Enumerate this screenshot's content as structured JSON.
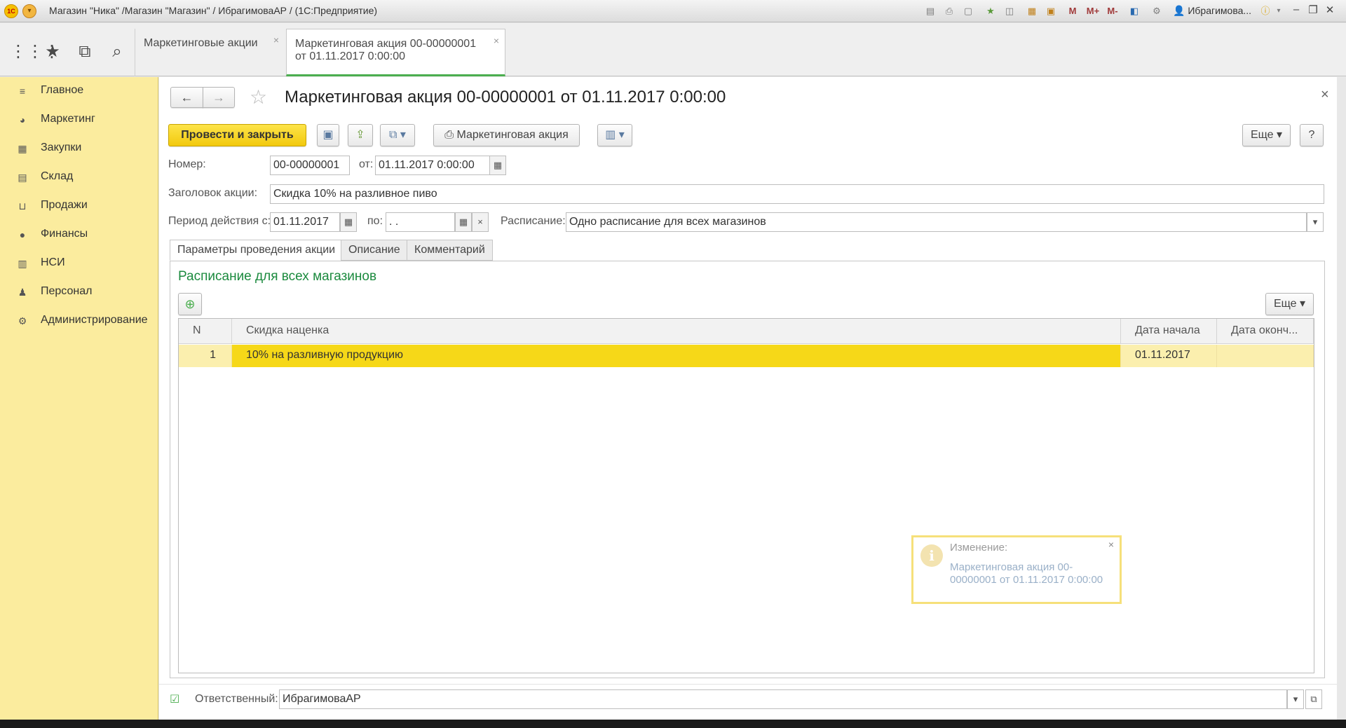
{
  "window": {
    "title": "Магазин \"Ника\" /Магазин \"Магазин\" / ИбрагимоваАР / (1С:Предприятие)",
    "user": "Ибрагимова...",
    "logo_text": "1С",
    "icons": [
      "save-icon",
      "print-icon",
      "preview-icon",
      "favorite-add-icon",
      "history-icon",
      "calculator-icon",
      "calendar-icon",
      "m-icon",
      "m-plus-icon",
      "m-minus-icon",
      "panel-icon",
      "tools-icon"
    ],
    "mem_labels": [
      "M",
      "M+",
      "M-"
    ]
  },
  "nav": {
    "icons": [
      "apps-grid-icon",
      "star-icon",
      "history-icon",
      "search-icon"
    ]
  },
  "tabs": [
    {
      "label": "Маркетинговые акции",
      "close": "×"
    },
    {
      "label_line1": "Маркетинговая акция 00-00000001",
      "label_line2": "от 01.11.2017 0:00:00",
      "close": "×"
    }
  ],
  "sidebar": {
    "items": [
      {
        "label": "Главное"
      },
      {
        "label": "Маркетинг"
      },
      {
        "label": "Закупки"
      },
      {
        "label": "Склад"
      },
      {
        "label": "Продажи"
      },
      {
        "label": "Финансы"
      },
      {
        "label": "НСИ"
      },
      {
        "label": "Персонал"
      },
      {
        "label": "Администрирование"
      }
    ]
  },
  "document": {
    "title": "Маркетинговая акция 00-00000001 от 01.11.2017 0:00:00",
    "close": "×",
    "toolbar": {
      "post_close": "Провести и закрыть",
      "print_label": "Маркетинговая акция",
      "more": "Еще",
      "help": "?"
    },
    "fields": {
      "number_label": "Номер:",
      "number_value": "00-00000001",
      "date_label": "от:",
      "date_value": "01.11.2017  0:00:00",
      "header_label": "Заголовок акции:",
      "header_value": "Скидка 10% на разливное пиво",
      "period_label": "Период действия с:",
      "period_from": "01.11.2017",
      "period_to_label": "по:",
      "period_to": " .  .",
      "schedule_label": "Расписание:",
      "schedule_value": "Одно расписание для всех магазинов"
    },
    "subtabs": [
      "Параметры проведения акции",
      "Описание",
      "Комментарий"
    ],
    "section_title": "Расписание для всех магазинов",
    "grid_more": "Еще",
    "grid": {
      "columns": [
        "N",
        "Скидка наценка",
        "Дата начала",
        "Дата оконч..."
      ],
      "rows": [
        {
          "n": "1",
          "discount": "10% на разливную продукцию",
          "start": "01.11.2017",
          "end": ""
        }
      ]
    },
    "footer": {
      "responsible_label": "Ответственный:",
      "responsible_value": "ИбрагимоваАР"
    }
  },
  "notification": {
    "title": "Изменение:",
    "text": "Маркетинговая акция 00-00000001 от 01.11.2017 0:00:00",
    "close": "×"
  },
  "colors": {
    "sidebar_bg": "#fbec9e",
    "primary_button": "#f6d818",
    "selected_row": "#f6d818",
    "section_title": "#1b8a3e",
    "active_tab_underline": "#4bae4f"
  }
}
